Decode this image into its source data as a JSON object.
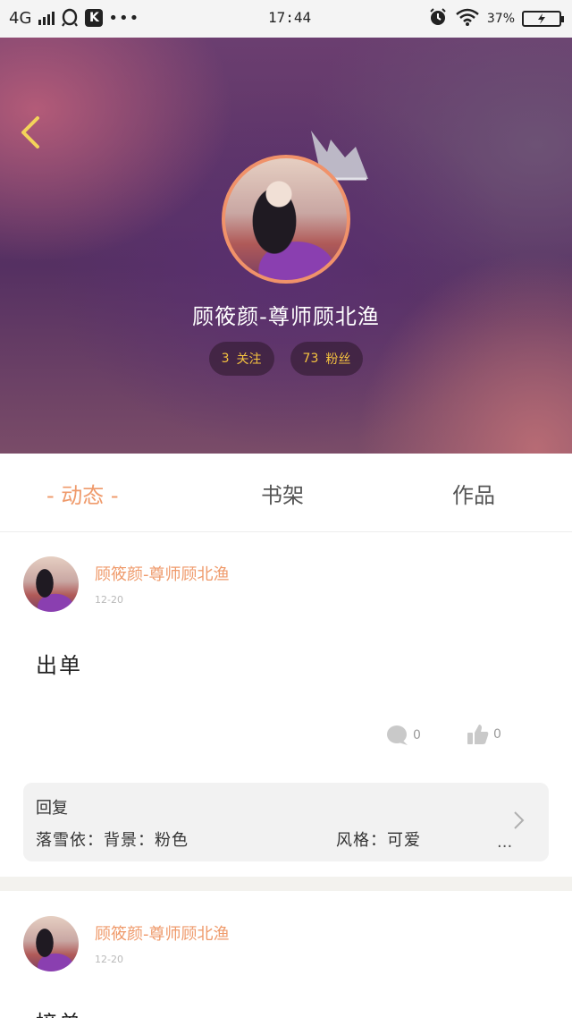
{
  "status_bar": {
    "network": "4G",
    "time": "17:44",
    "battery": "37",
    "icons": [
      "qq-icon",
      "k-app-icon",
      "more-dots-icon",
      "alarm-icon",
      "wifi-icon",
      "battery-icon"
    ]
  },
  "profile": {
    "name": "顾筱颜-尊师顾北渔",
    "following_count": "3",
    "following_label": "关注",
    "followers_count": "73",
    "followers_label": "粉丝"
  },
  "tabs": [
    {
      "label": "- 动态 -",
      "active": true
    },
    {
      "label": "书架",
      "active": false
    },
    {
      "label": "作品",
      "active": false
    }
  ],
  "posts": [
    {
      "author": "顾筱颜-尊师顾北渔",
      "date": "12-20",
      "content": "出单",
      "comments": "0",
      "likes": "0",
      "reply": {
        "title": "回复",
        "text": "落雪依：背景：粉色",
        "style": "风格：可爱",
        "more": "..."
      }
    },
    {
      "author": "顾筱颜-尊师顾北渔",
      "date": "12-20",
      "content": "接单"
    }
  ],
  "colors": {
    "accent": "#ef9a6b",
    "stat_text": "#f5c23f",
    "avatar_border": "#f0926a",
    "back_arrow": "#f3d35a"
  }
}
